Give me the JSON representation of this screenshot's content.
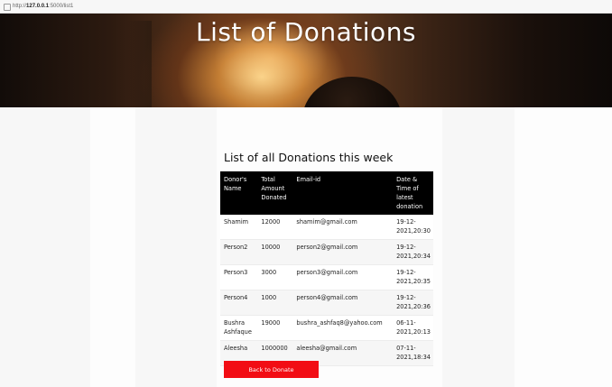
{
  "browser": {
    "url_prefix": "http://",
    "url_host": "127.0.0.1",
    "url_path": ":5000/list1"
  },
  "hero": {
    "title": "List of Donations"
  },
  "section": {
    "title": "List of all Donations this week"
  },
  "table": {
    "headers": [
      "Donor's Name",
      "Total Amount Donated",
      "Email-id",
      "Date & Time of latest donation"
    ],
    "rows": [
      [
        "Shamim",
        "12000",
        "shamim@gmail.com",
        "19-12-2021,20:30"
      ],
      [
        "Person2",
        "10000",
        "person2@gmail.com",
        "19-12-2021,20:34"
      ],
      [
        "Person3",
        "3000",
        "person3@gmail.com",
        "19-12-2021,20:35"
      ],
      [
        "Person4",
        "1000",
        "person4@gmail.com",
        "19-12-2021,20:36"
      ],
      [
        "Bushra Ashfaque",
        "19000",
        "bushra_ashfaq8@yahoo.com",
        "06-11-2021,20:13"
      ],
      [
        "Aleesha",
        "1000000",
        "aleesha@gmail.com",
        "07-11-2021,18:34"
      ]
    ]
  },
  "button": {
    "back_label": "Back to Donate"
  },
  "colors": {
    "button": "#f20d14",
    "table_header": "#000000"
  }
}
